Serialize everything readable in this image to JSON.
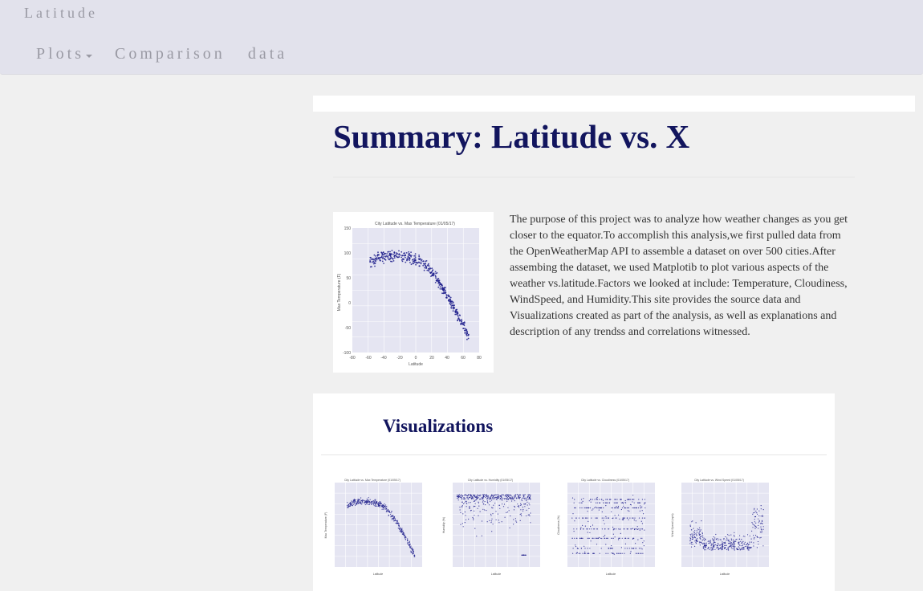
{
  "navbar": {
    "brand": "Latitude",
    "items": [
      {
        "label": "Plots",
        "has_dropdown": true
      },
      {
        "label": "Comparison",
        "has_dropdown": false
      },
      {
        "label": "data",
        "has_dropdown": false
      }
    ]
  },
  "main": {
    "title": "Summary: Latitude vs. X",
    "description": "The purpose of this project was to analyze how weather changes as you get closer to the equator.To accomplish this analysis,we first pulled data from the OpenWeatherMap API to assemble a dataset on over 500 cities.After assembing the dataset, we used Matplotib to plot various aspects of the weather vs.latitude.Factors we looked at include: Temperature, Cloudiness, WindSpeed, and Humidity.This site provides the source data and Visualizations created as part of the analysis, as well as explanations and description of any trendss and correlations witnessed."
  },
  "summary_plot": {
    "title": "City Latitude vs. Max Temperature (01/05/17)",
    "xlabel": "Latitude",
    "ylabel": "Max Temperature (F)",
    "yticks": [
      "150",
      "100",
      "50",
      "0",
      "-50",
      "-100"
    ],
    "xticks": [
      "-80",
      "-60",
      "-40",
      "-20",
      "0",
      "20",
      "40",
      "60",
      "80"
    ]
  },
  "visualizations": {
    "heading": "Visualizations",
    "plots": [
      {
        "title": "City Latitude vs. Max Temperature (01/05/17)",
        "xlabel": "Latitude",
        "ylabel": "Max Temperature (F)"
      },
      {
        "title": "City Latitude vs. Humidity (01/05/17)",
        "xlabel": "Latitude",
        "ylabel": "Humidity (%)"
      },
      {
        "title": "City Latitude vs. Cloudiness (01/05/17)",
        "xlabel": "Latitude",
        "ylabel": "Cloudiness (%)"
      },
      {
        "title": "City Latitude vs. Wind Speed (01/05/17)",
        "xlabel": "Latitude",
        "ylabel": "Wind Speed (mph)"
      }
    ]
  },
  "colors": {
    "accent": "#12155e",
    "nav_bg": "#e2e2ec",
    "nav_text": "#9a9aa4",
    "plot_bg": "#e5e5f2",
    "marker": "#1f1f8c"
  }
}
